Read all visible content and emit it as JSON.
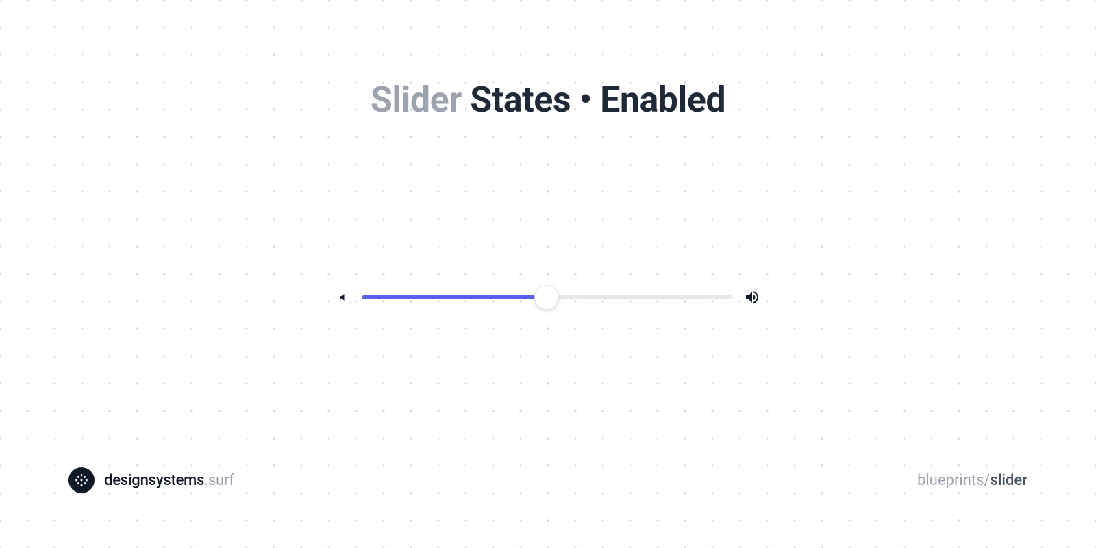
{
  "title": {
    "muted": "Slider",
    "strong": " States • Enabled"
  },
  "slider": {
    "value_percent": 50,
    "fill_color": "#5b5ef4",
    "track_color": "#e5e7eb"
  },
  "icons": {
    "left": "volume-mute-icon",
    "right": "volume-up-icon"
  },
  "footer": {
    "brand_strong": "designsystems",
    "brand_muted": ".surf",
    "crumb_muted": "blueprints/",
    "crumb_strong": "slider"
  }
}
